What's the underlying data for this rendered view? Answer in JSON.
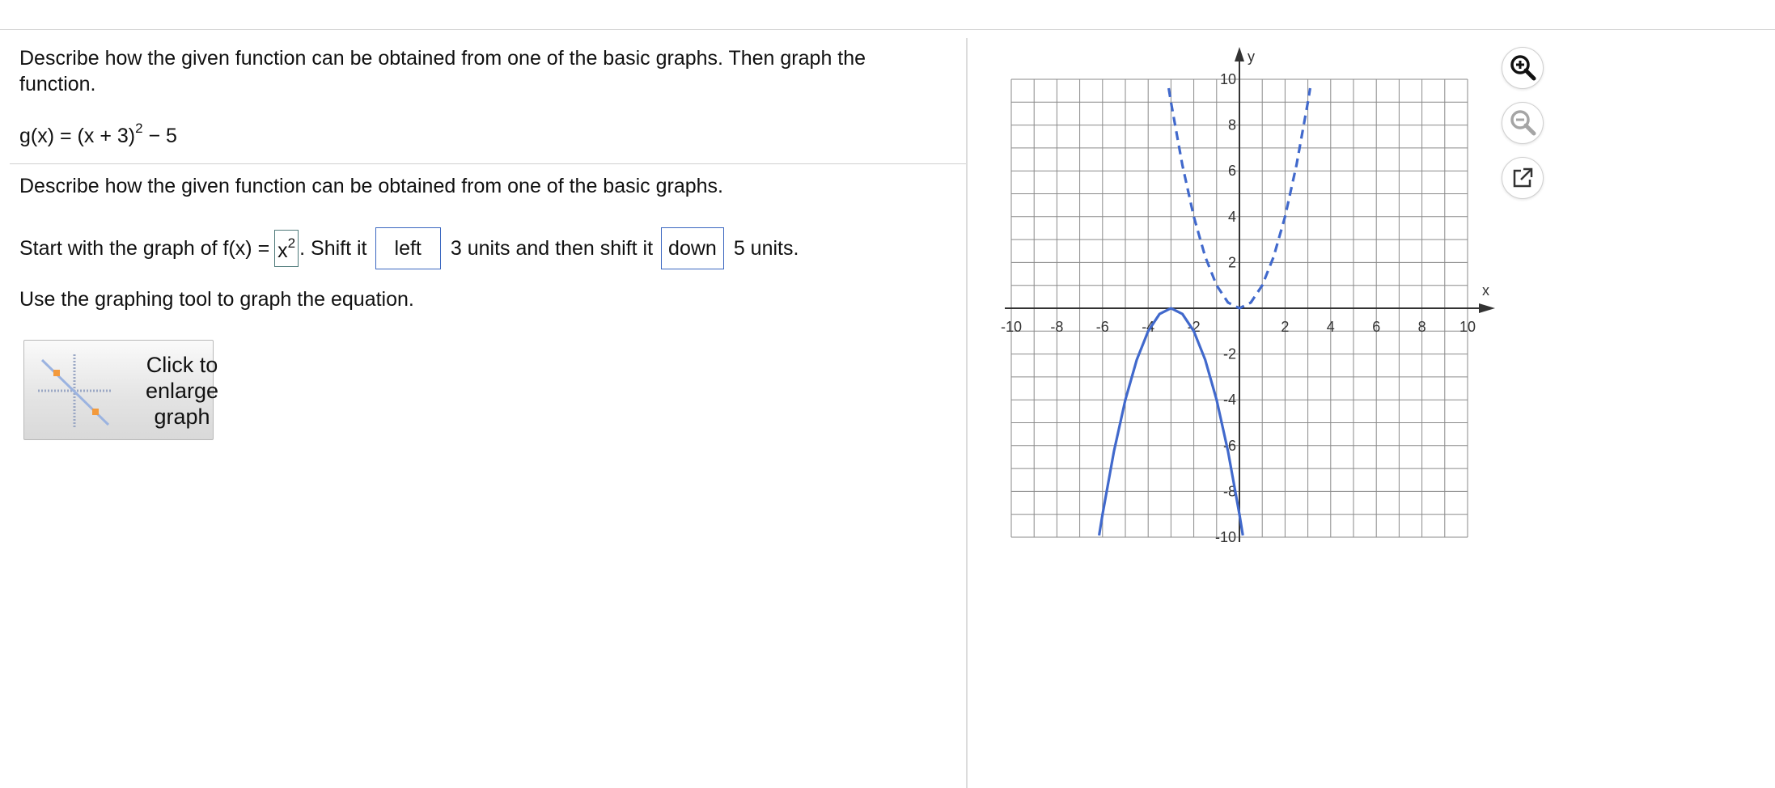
{
  "question": {
    "instruction": "Describe how the given function can be obtained from one of the basic graphs. Then graph the function.",
    "function_prefix": "g(x) = (x + 3)",
    "function_exponent": "2",
    "function_suffix": " − 5"
  },
  "answer": {
    "describe_prompt": "Describe how the given function can be obtained from one of the basic graphs.",
    "start_text": "Start with the graph of f(x) =",
    "basic_base": "x",
    "basic_exponent": "2",
    "shift_text": ". Shift it",
    "shift_direction_1": "left",
    "middle_text": "3 units and then shift it",
    "shift_direction_2": "down",
    "end_text": "5 units.",
    "use_tool": "Use the graphing tool to graph the equation."
  },
  "enlarge_button": {
    "label": "Click to\nenlarge\ngraph"
  },
  "toolbar": {
    "zoom_in_icon": "zoom-in-icon",
    "zoom_out_icon": "zoom-out-icon",
    "popout_icon": "external-link-icon"
  },
  "chart_data": {
    "type": "line",
    "xlabel": "x",
    "ylabel": "y",
    "xlim": [
      -10,
      10
    ],
    "ylim": [
      -10,
      10
    ],
    "grid": true,
    "x_tick_labels": [
      "-10",
      "-8",
      "-6",
      "-4",
      "-2",
      "2",
      "4",
      "6",
      "8",
      "10"
    ],
    "y_tick_labels": [
      "10",
      "8",
      "6",
      "4",
      "2",
      "-2",
      "-4",
      "-6",
      "-8",
      "-10"
    ],
    "series": [
      {
        "style": "dashed",
        "color": "#4169cc",
        "function": "x^2",
        "x": [
          -3.1,
          -3,
          -2.5,
          -2,
          -1.5,
          -1,
          -0.5,
          0,
          0.5,
          1,
          1.5,
          2,
          2.5,
          3,
          3.1
        ],
        "y": [
          9.61,
          9,
          6.25,
          4,
          2.25,
          1,
          0.25,
          0,
          0.25,
          1,
          2.25,
          4,
          6.25,
          9,
          9.61
        ]
      },
      {
        "style": "solid",
        "color": "#4169cc",
        "function": "-(x+3)^2",
        "x": [
          -6.15,
          -6,
          -5.5,
          -5,
          -4.5,
          -4,
          -3.5,
          -3,
          -2.5,
          -2,
          -1.5,
          -1,
          -0.5,
          0,
          0.15
        ],
        "y": [
          -9.92,
          -9,
          -6.25,
          -4,
          -2.25,
          -1,
          -0.25,
          0,
          -0.25,
          -1,
          -2.25,
          -4,
          -6.25,
          -9,
          -9.92
        ]
      }
    ]
  }
}
